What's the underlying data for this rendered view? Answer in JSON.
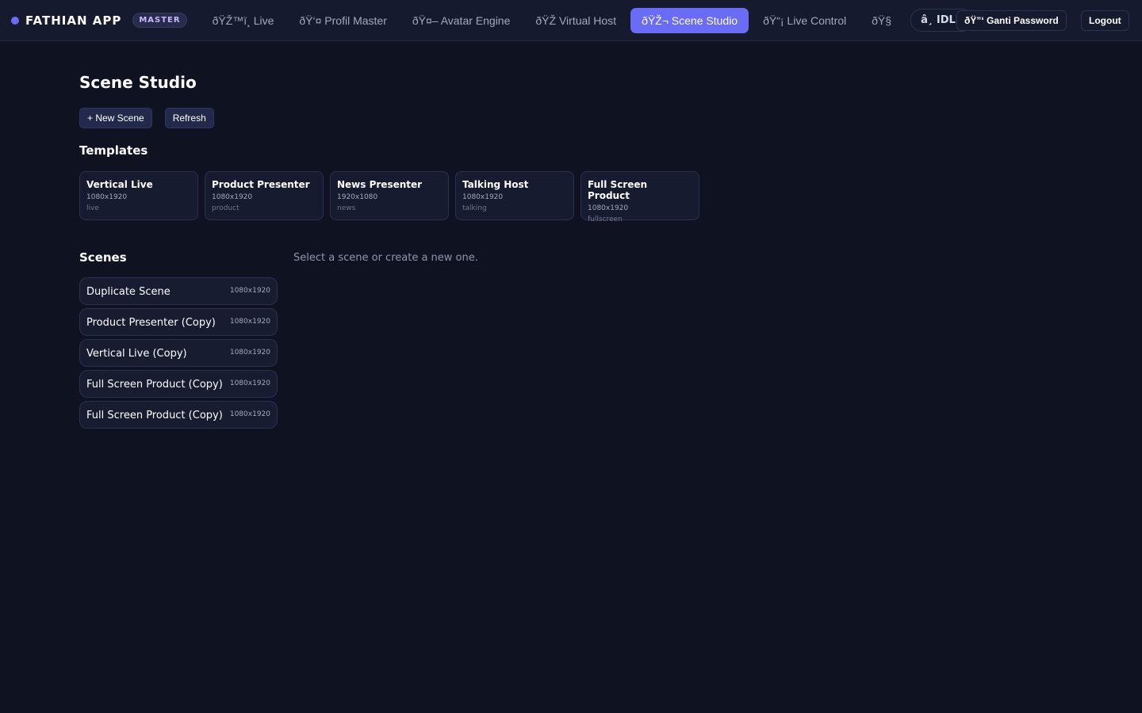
{
  "header": {
    "brand": "FATHIAN APP",
    "role_badge": "MASTER",
    "nav": [
      {
        "label": "ðŸŽ™ï¸ Live",
        "active": false
      },
      {
        "label": "ðŸ‘¤ Profil Master",
        "active": false
      },
      {
        "label": "ðŸ¤– Avatar Engine",
        "active": false
      },
      {
        "label": "ðŸŽ Virtual Host",
        "active": false
      },
      {
        "label": "ðŸŽ¬ Scene Studio",
        "active": true
      },
      {
        "label": "ðŸ“¡ Live Control",
        "active": false
      },
      {
        "label": "ðŸ§",
        "active": false
      }
    ],
    "status": "â¸ IDLE",
    "change_password_label": "ðŸ”‘ Ganti Password",
    "logout_label": "Logout"
  },
  "page": {
    "title": "Scene Studio",
    "new_scene_label": "+ New Scene",
    "refresh_label": "Refresh",
    "templates_title": "Templates",
    "templates": [
      {
        "name": "Vertical Live",
        "size": "1080x1920",
        "tag": "live"
      },
      {
        "name": "Product Presenter",
        "size": "1080x1920",
        "tag": "product"
      },
      {
        "name": "News Presenter",
        "size": "1920x1080",
        "tag": "news"
      },
      {
        "name": "Talking Host",
        "size": "1080x1920",
        "tag": "talking"
      },
      {
        "name": "Full Screen Product",
        "size": "1080x1920",
        "tag": "fullscreen"
      }
    ],
    "scenes_title": "Scenes",
    "scenes": [
      {
        "name": "Duplicate Scene",
        "size": "1080x1920"
      },
      {
        "name": "Product Presenter (Copy)",
        "size": "1080x1920"
      },
      {
        "name": "Vertical Live (Copy)",
        "size": "1080x1920"
      },
      {
        "name": "Full Screen Product (Copy)",
        "size": "1080x1920"
      },
      {
        "name": "Full Screen Product (Copy)",
        "size": "1080x1920"
      }
    ],
    "empty_message": "Select a scene or create a new one."
  },
  "colors": {
    "background": "#0f1221",
    "accent": "#6b6cf6",
    "card": "#161b30"
  }
}
